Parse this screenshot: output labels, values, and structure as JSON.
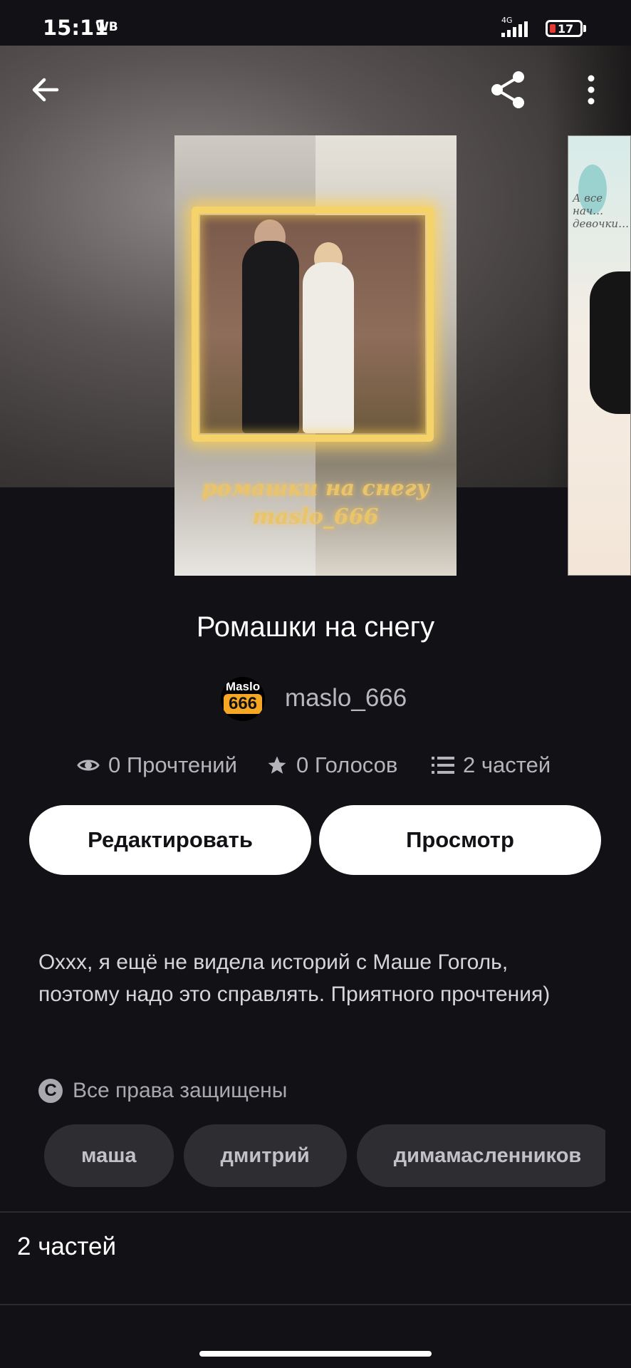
{
  "status_bar": {
    "time": "15:11",
    "carrier_badge": "WB",
    "network": "4G",
    "battery": "17"
  },
  "app_bar": {
    "back_icon": "arrow-left-icon",
    "share_icon": "share-icon",
    "more_icon": "more-vertical-icon"
  },
  "cover": {
    "caption_line1": "ромашки на снегу",
    "caption_line2": "maslo_666",
    "next_cover_text": "А все нач… девочки…"
  },
  "story": {
    "title": "Ромашки на снегу",
    "author": {
      "avatar_line1": "Maslo",
      "avatar_line2": "666",
      "name": "maslo_666"
    },
    "stats": {
      "reads": "0 Прочтений",
      "votes": "0 Голосов",
      "parts": "2 частей"
    },
    "actions": {
      "edit_label": "Редактировать",
      "view_label": "Просмотр"
    },
    "description": "Оххх, я ещё не видела историй с Маше Гоголь, поэтому надо это справлять. Приятного прочтения)",
    "copyright": "Все права защищены",
    "tags": [
      "маша",
      "дмитрий",
      "димамасленников"
    ],
    "parts_heading": "2 частей"
  },
  "colors": {
    "background": "#121115",
    "button_bg": "#ffffff",
    "tag_bg": "#2e2d32",
    "accent_gold": "#e9c46a"
  }
}
